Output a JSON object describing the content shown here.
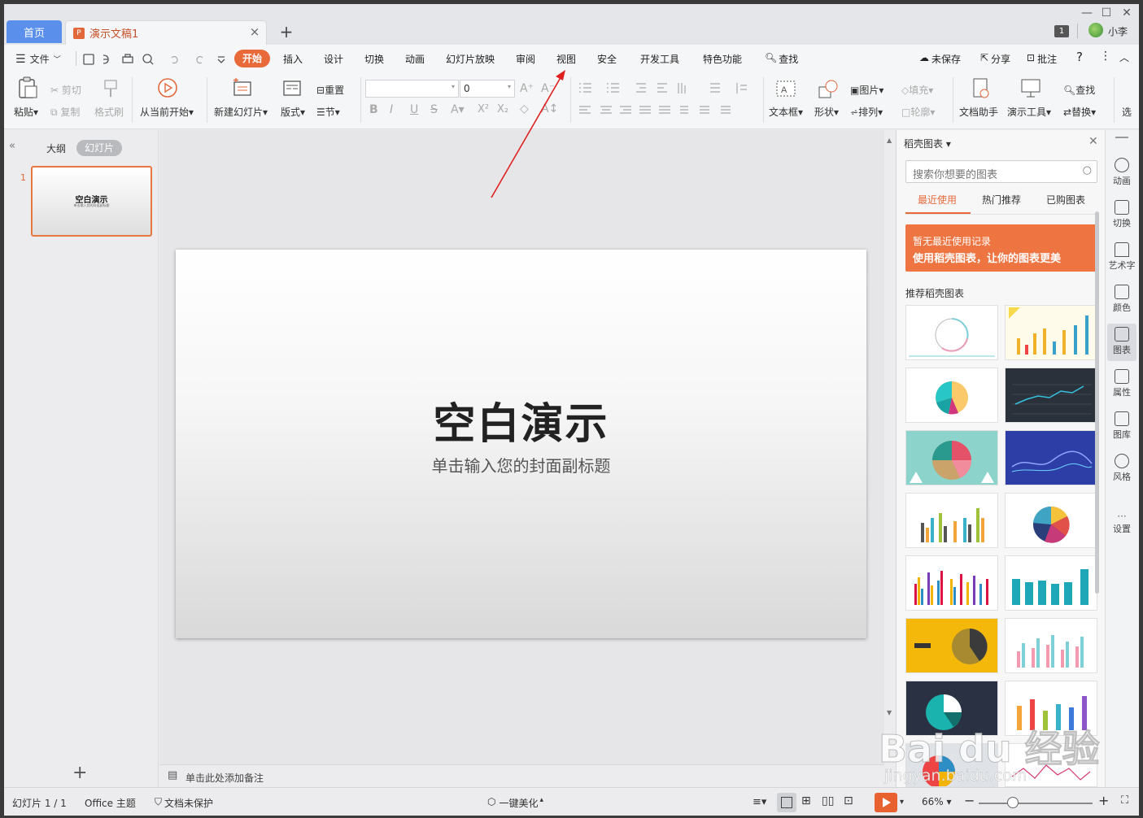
{
  "tabs": {
    "home": "首页",
    "doc": "演示文稿1"
  },
  "account": {
    "badge": "1",
    "user": "小李"
  },
  "menu": {
    "file": "文件",
    "items": [
      "开始",
      "插入",
      "设计",
      "切换",
      "动画",
      "幻灯片放映",
      "审阅",
      "视图",
      "安全",
      "开发工具",
      "特色功能"
    ],
    "search": "查找",
    "right": {
      "unsaved": "未保存",
      "share": "分享",
      "comment": "批注"
    }
  },
  "ribbon": {
    "paste": "粘贴",
    "cut": "剪切",
    "copy": "复制",
    "format_painter": "格式刷",
    "from_current": "从当前开始",
    "new_slide": "新建幻灯片",
    "layout": "版式",
    "reset": "重置",
    "section": "节",
    "font_size": "0",
    "textbox": "文本框",
    "shape": "形状",
    "image": "图片",
    "arrange": "排列",
    "fill": "填充",
    "outline": "轮廓",
    "doc_helper": "文档助手",
    "present_tools": "演示工具",
    "find": "查找",
    "replace": "替换",
    "more": "选"
  },
  "left_pane": {
    "outline": "大纲",
    "slides": "幻灯片",
    "slide_num": "1",
    "thumb_title": "空白演示",
    "thumb_sub": "单击输入您的封面副标题"
  },
  "slide": {
    "title": "空白演示",
    "subtitle": "单击输入您的封面副标题"
  },
  "notes": {
    "placeholder": "单击此处添加备注"
  },
  "chart_panel": {
    "title": "稻壳图表",
    "search_placeholder": "搜索你想要的图表",
    "tabs": [
      "最近使用",
      "热门推荐",
      "已购图表"
    ],
    "banner_line1": "暂无最近使用记录",
    "banner_line2": "使用稻壳图表，让你的图表更美",
    "section": "推荐稻壳图表"
  },
  "rail": [
    "动画",
    "切换",
    "艺术字",
    "颜色",
    "图表",
    "属性",
    "图库",
    "风格",
    "设置"
  ],
  "status": {
    "slide": "幻灯片 1 / 1",
    "theme": "Office 主题",
    "protect": "文档未保护",
    "beautify": "一键美化",
    "zoom": "66%"
  },
  "watermark": {
    "line1": "Bai du 经验",
    "line2": "jingyan.baidu.com"
  },
  "colors": {
    "accent": "#e8693a",
    "home_tab": "#5b8fec",
    "annotation": "#e02020"
  }
}
